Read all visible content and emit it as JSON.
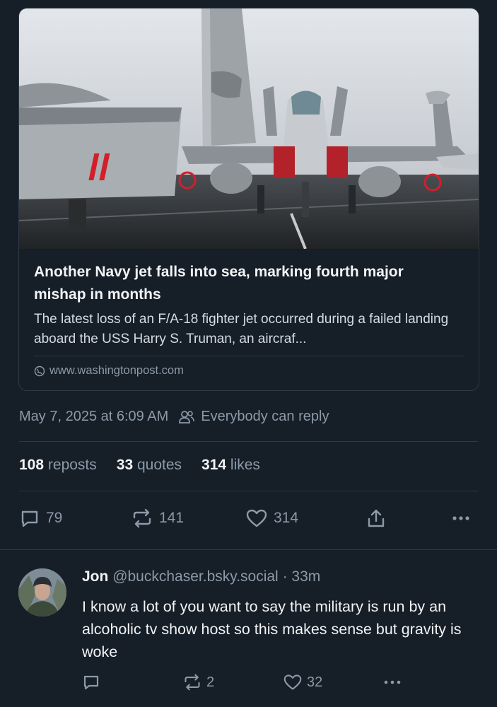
{
  "link_card": {
    "title": "Another Navy jet falls into sea, marking fourth major mishap in months",
    "description": "The latest loss of an F/A-18 fighter jet occurred during a failed landing aboard the USS Harry S. Truman, an aircraf...",
    "domain": "www.washingtonpost.com",
    "image_icon": "fighter-jet-photo"
  },
  "post_meta": {
    "timestamp": "May 7, 2025 at 6:09 AM",
    "reply_setting": "Everybody can reply"
  },
  "stats": {
    "reposts_count": "108",
    "reposts_label": "reposts",
    "quotes_count": "33",
    "quotes_label": "quotes",
    "likes_count": "314",
    "likes_label": "likes"
  },
  "actions": {
    "reply_count": "79",
    "repost_count": "141",
    "like_count": "314"
  },
  "reply": {
    "name": "Jon",
    "handle": "@buckchaser.bsky.social",
    "separator": "·",
    "time": "33m",
    "text": "I know a lot of you want to say the military is run by an alcoholic tv show host so this makes sense but gravity is woke",
    "repost_count": "2",
    "like_count": "32"
  }
}
